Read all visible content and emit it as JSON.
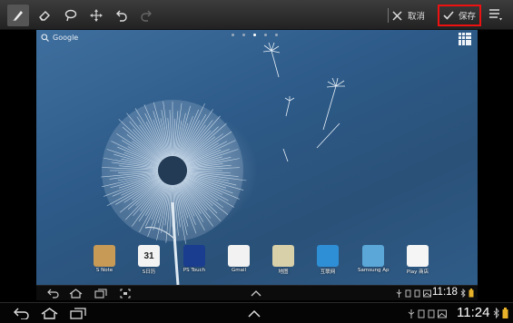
{
  "toolbar": {
    "tools": [
      "pen-tool",
      "eraser-tool",
      "lasso-tool",
      "move-tool",
      "undo",
      "redo"
    ],
    "cancel_label": "取消",
    "save_label": "保存"
  },
  "home": {
    "search_label": "Google",
    "page_indicator": {
      "count": 5,
      "active": 3
    },
    "dock": [
      {
        "label": "S Note",
        "icon": "s-note-icon",
        "color": "#c79a55"
      },
      {
        "label": "S日历",
        "icon": "calendar-icon",
        "color": "#f3f3f3",
        "badge": "31"
      },
      {
        "label": "PS Touch",
        "icon": "ps-touch-icon",
        "color": "#1b3d8f"
      },
      {
        "label": "Gmail",
        "icon": "gmail-icon",
        "color": "#f2f2f2"
      },
      {
        "label": "地图",
        "icon": "maps-icon",
        "color": "#d8d0a8"
      },
      {
        "label": "互联网",
        "icon": "internet-icon",
        "color": "#2f8fd6"
      },
      {
        "label": "Samsung Ap",
        "icon": "samsung-apps-icon",
        "color": "#5aa7d8"
      },
      {
        "label": "Play 商店",
        "icon": "play-store-icon",
        "color": "#f5f5f5"
      }
    ]
  },
  "inner_status": {
    "time": "11:18"
  },
  "outer_status": {
    "time": "11:24"
  },
  "colors": {
    "highlight": "#e11111",
    "accent": "#33b5e5"
  }
}
